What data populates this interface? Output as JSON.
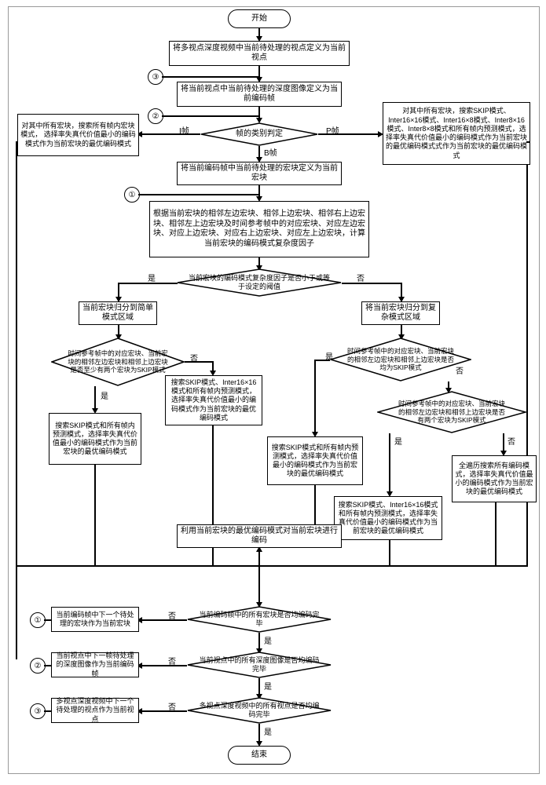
{
  "terminals": {
    "start": "开始",
    "end": "结束"
  },
  "refs": {
    "r1": "①",
    "r2": "②",
    "r3": "③"
  },
  "edges": {
    "yes": "是",
    "no": "否",
    "i": "I帧",
    "p": "P帧",
    "b": "B帧"
  },
  "boxes": {
    "b1": "将多视点深度视频中当前待处理的视点定义为当前视点",
    "b2": "将当前视点中当前待处理的深度图像定义为当前编码帧",
    "b3": "帧的类别判定",
    "b4": "对其中所有宏块，搜索所有帧内宏块模式，\n选择率失真代价值最小的编码模式作为当前宏块的最优编码模式",
    "b5": "对其中所有宏块，搜索SKIP模式、Inter16×16模式、Inter16×8模式、Inter8×16模式、Inter8×8模式和所有帧内预测模式，选择率失真代价值最小的编码模式作为当前宏块的最优编码模式式作为当前宏块的最优编码模式",
    "b6": "将当前编码帧中当前待处理的宏块定义为当前宏块",
    "b7": "根据当前宏块的相邻左边宏块、相邻上边宏块、相邻右上边宏块、相邻左上边宏块及时间参考帧中的对应宏块、对应左边宏块、对应上边宏块、对应右上边宏块、对应左上边宏块，计算当前宏块的编码模式复杂度因子",
    "d1": "当前宏块的编码模式复杂度因子是否小于或等于设定的阈值",
    "b8": "当前宏块归分到简单模式区域",
    "b9": "将当前宏块归分到复杂模式区域",
    "d2": "时间参考帧中的对应宏块、当前宏块的相邻左边宏块和相邻上边宏块是否至少有两个宏块为SKIP模式",
    "d3": "时间参考帧中的对应宏块、当前宏块的相邻左边宏块和相邻上边宏块是否均为SKIP模式",
    "d4": "时间参考帧中的对应宏块、当前宏块的相邻左边宏块和相邻上边宏块是否有两个宏块为SKIP模式",
    "b10": "搜索SKIP模式和所有帧内预测模式，选择率失真代价值最小的编码模式作为当前宏块的最优编码模式",
    "b11": "搜索SKIP模式、Inter16×16模式和所有帧内预测模式，选择率失真代价值最小的编码模式作为当前宏块的最优编码模式",
    "b12": "搜索SKIP模式和所有帧内预测模式，选择率失真代价值最小的编码模式作为当前宏块的最优编码模式",
    "b13": "搜索SKIP模式、Inter16×16模式和所有帧内预测模式，选择率失真代价值最小的编码模式作为当前宏块的最优编码模式",
    "b14": "全遍历搜索所有编码模式，选择率失真代价值最小的编码模式作为当前宏块的最优编码模式",
    "b15": "利用当前宏块的最优编码模式对当前宏块进行编码",
    "d5": "当前编码帧中的所有宏块是否均编码完毕",
    "b16": "当前编码帧中下一个待处理的宏块作为当前宏块",
    "d6": "当前视点中的所有深度图像是否均编码完毕",
    "b17": "当前视点中下一帧待处理的深度图像作为当前编码帧",
    "d7": "多视点深度视频中的所有视点是否均编码完毕",
    "b18": "多视点深度视频中下一个待处理的视点作为当前视点"
  }
}
